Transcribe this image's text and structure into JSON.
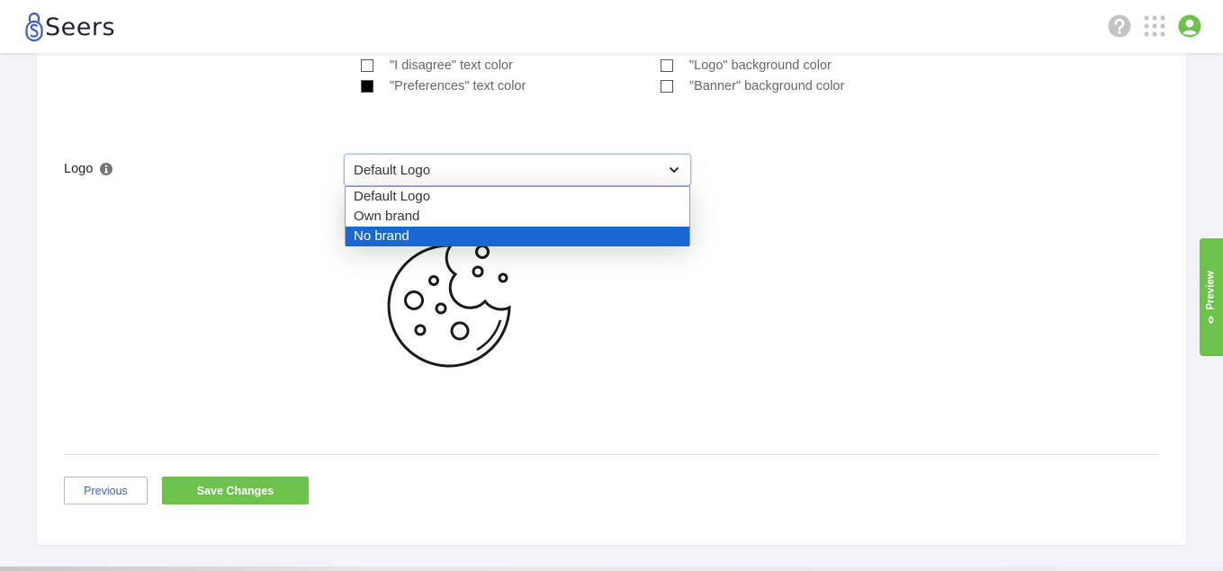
{
  "header": {
    "brand": "Seers",
    "icons": [
      "help-icon",
      "apps-grid-icon",
      "user-account-icon"
    ]
  },
  "colors_section": {
    "left": [
      {
        "label": "\"I disagree\" text color",
        "swatch": "#ffffff"
      },
      {
        "label": "\"Preferences\" text color",
        "swatch": "#000000"
      }
    ],
    "right": [
      {
        "label": "\"Logo\" background color",
        "swatch": "#ffffff"
      },
      {
        "label": "\"Banner\" background color",
        "swatch": "#ffffff"
      }
    ]
  },
  "logo": {
    "label": "Logo",
    "selected": "Default Logo",
    "options": [
      "Default Logo",
      "Own brand",
      "No brand"
    ],
    "highlighted": "No brand"
  },
  "footer": {
    "previous_label": "Previous",
    "save_label": "Save Changes"
  },
  "preview_tab": {
    "label": "Preview"
  },
  "theme": {
    "accent_green": "#6cc24a",
    "link_blue": "#3a5fc8",
    "highlight_blue": "#1967d2"
  }
}
